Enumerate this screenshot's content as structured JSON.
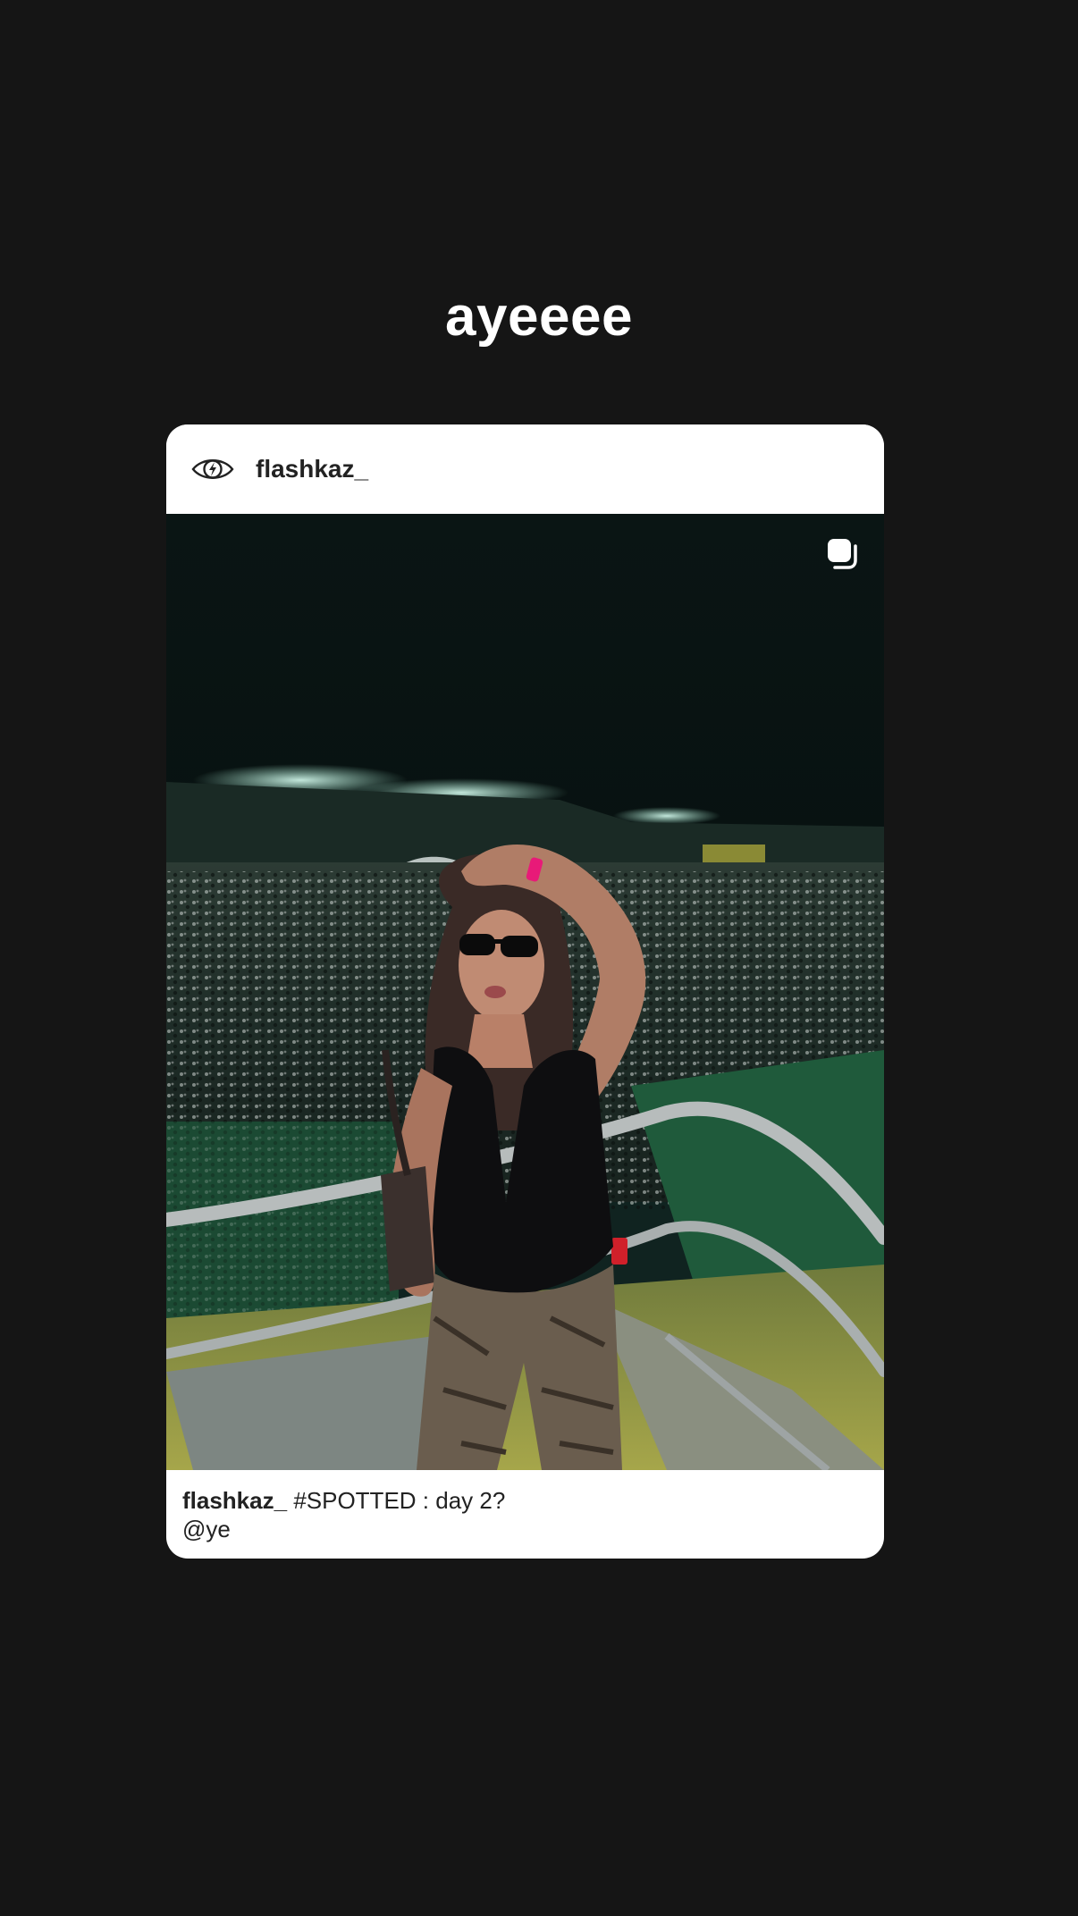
{
  "page": {
    "title": "ayeeee"
  },
  "post": {
    "username": "flashkaz_",
    "header_icon": "eye-lightning-icon",
    "media_badge_icon": "multiple-images-icon",
    "caption": {
      "username": "flashkaz_",
      "text": "#SPOTTED : day 2?",
      "mention": "@ye"
    }
  },
  "colors": {
    "background": "#151515",
    "card": "#ffffff",
    "text": "#222222"
  }
}
